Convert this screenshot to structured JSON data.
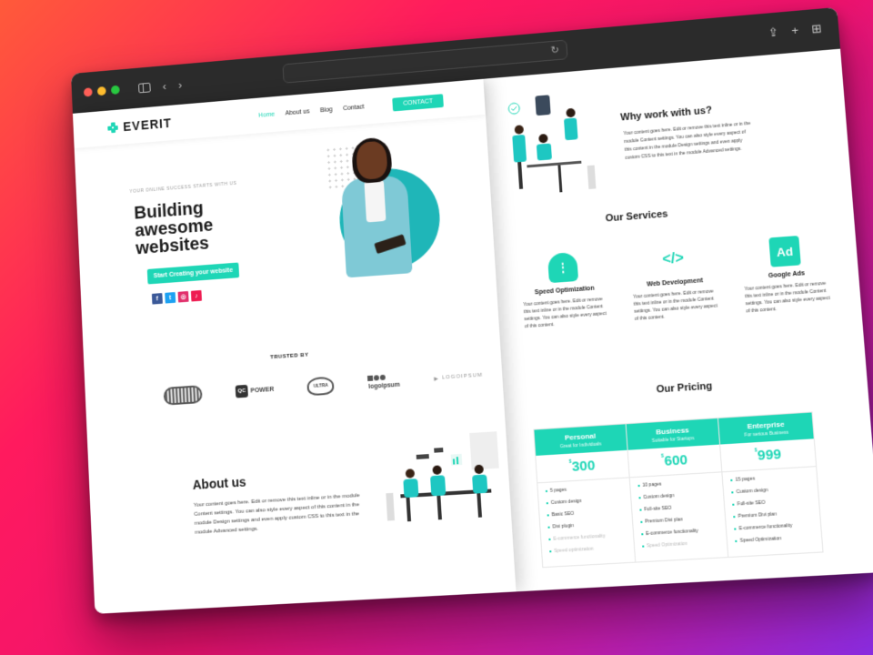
{
  "browser": {
    "traffic_lights": [
      "close",
      "minimize",
      "maximize"
    ],
    "toolbar_icons": [
      "sidebar-icon",
      "back-icon",
      "forward-icon"
    ],
    "url": "",
    "right_icons": [
      "share-icon",
      "new-tab-icon",
      "tab-overview-icon"
    ]
  },
  "site": {
    "brand": "EVERIT",
    "nav": [
      {
        "label": "Home",
        "active": true
      },
      {
        "label": "About us",
        "active": false
      },
      {
        "label": "Blog",
        "active": false
      },
      {
        "label": "Contact",
        "active": false
      }
    ],
    "contact_button": "CONTACT",
    "accent_color": "#1ed6b6"
  },
  "hero": {
    "eyebrow": "YOUR ONLINE SUCCESS STARTS WITH US",
    "headline": "Building awesome websites",
    "cta": "Start Creating your website",
    "socials": [
      {
        "icon": "facebook-icon",
        "glyph": "f",
        "color": "#3b5998"
      },
      {
        "icon": "twitter-icon",
        "glyph": "t",
        "color": "#1da1f2"
      },
      {
        "icon": "instagram-icon",
        "glyph": "◎",
        "color": "#e1306c"
      },
      {
        "icon": "tiktok-icon",
        "glyph": "♪",
        "color": "#ee1d52"
      }
    ]
  },
  "trusted": {
    "title": "TRUSTED BY",
    "logos": [
      "badge-logo",
      "QC POWER MODULE",
      "ULTRA",
      "logoipsum",
      "LOGOIPSUM"
    ]
  },
  "about": {
    "title": "About us",
    "text": "Your content goes here. Edit or remove this text inline or in the module Content settings. You can also style every aspect of this content in the module Design settings and even apply custom CSS to this text in the module Advanced settings."
  },
  "why": {
    "title": "Why work with us?",
    "text": "Your content goes here. Edit or remove this text inline or in the module Content settings. You can also style every aspect of this content in the module Design settings and even apply custom CSS to this text in the module Advanced settings."
  },
  "services": {
    "title": "Our Services",
    "items": [
      {
        "title": "Speed Optimization",
        "icon": "gauge-icon",
        "text": "Your content goes here. Edit or remove this text inline or in the module Content settings. You can also style every aspect of this content."
      },
      {
        "title": "Web Development",
        "icon": "code-icon",
        "text": "Your content goes here. Edit or remove this text inline or in the module Content settings. You can also style every aspect of this content."
      },
      {
        "title": "Google Ads",
        "icon": "ad-icon",
        "text": "Your content goes here. Edit or remove this text inline or in the module Content settings. You can also style every aspect of this content."
      }
    ]
  },
  "pricing": {
    "title": "Our Pricing",
    "currency": "$",
    "plans": [
      {
        "name": "Personal",
        "subtitle": "Great for Individuals",
        "price": "300",
        "features": [
          "5 pages",
          "Custom design",
          "Basic SEO",
          "Divi plugin",
          "E-commerce functionality",
          "Speed optimization"
        ],
        "dim_from": 4
      },
      {
        "name": "Business",
        "subtitle": "Suitable for Startups",
        "price": "600",
        "features": [
          "10 pages",
          "Custom design",
          "Full-site SEO",
          "Premium Divi plan",
          "E-commerce functionality",
          "Speed Optimization"
        ],
        "dim_from": 5
      },
      {
        "name": "Enterprise",
        "subtitle": "For serious Business",
        "price": "999",
        "features": [
          "15 pages",
          "Custom design",
          "Full-site SEO",
          "Premium Divi plan",
          "E-commerce functionality",
          "Speed Optimization"
        ],
        "dim_from": 6
      }
    ]
  }
}
